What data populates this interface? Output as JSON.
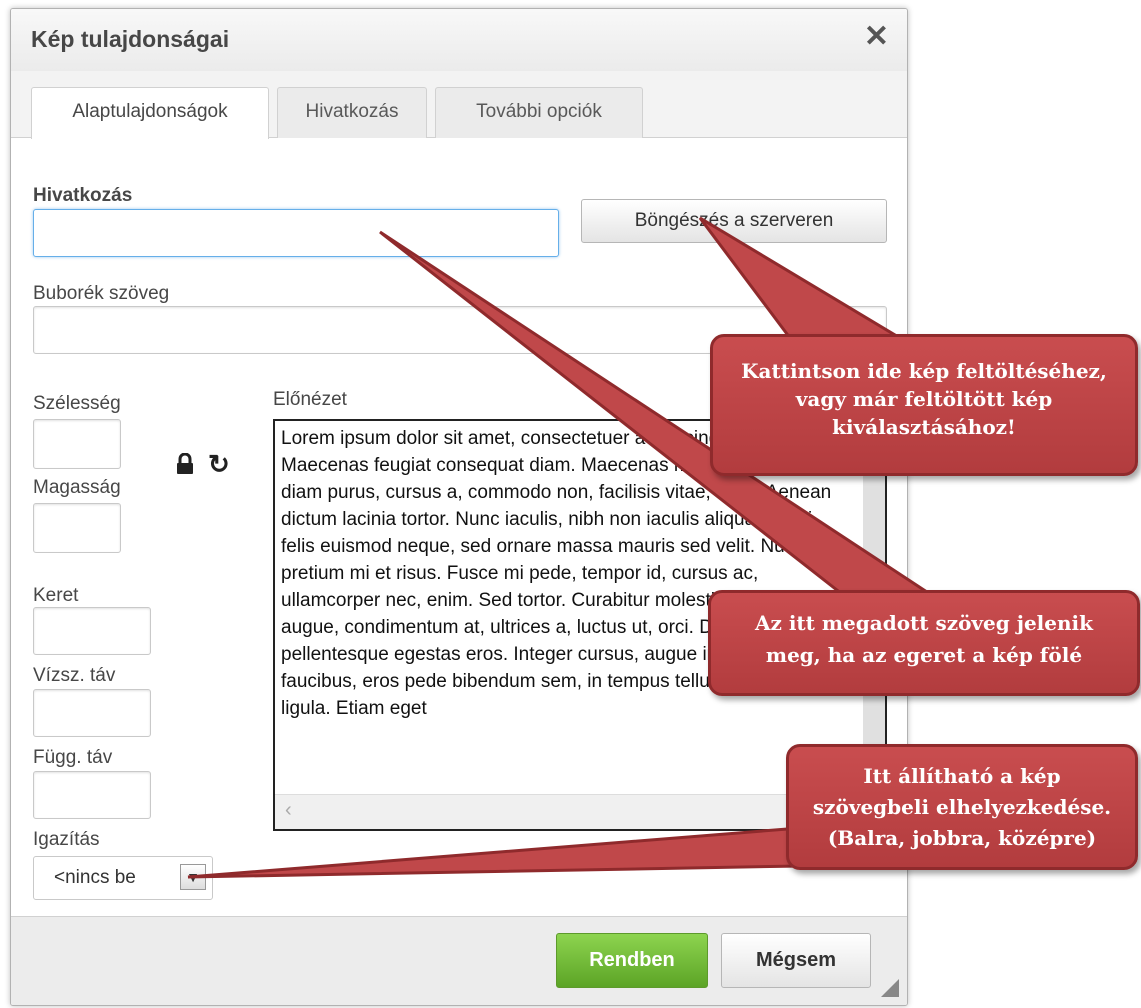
{
  "dialog": {
    "title": "Kép tulajdonságai",
    "close_icon": "close-icon"
  },
  "tabs": [
    {
      "label": "Alaptulajdonságok",
      "active": true
    },
    {
      "label": "Hivatkozás",
      "active": false
    },
    {
      "label": "További opciók",
      "active": false
    }
  ],
  "form": {
    "url_label": "Hivatkozás",
    "url_value": "",
    "browse_button": "Böngészés a szerveren",
    "alt_label": "Buborék szöveg",
    "alt_value": "",
    "width_label": "Szélesség",
    "height_label": "Magasság",
    "lock_icon": "lock-icon",
    "reset_icon": "reset-size-icon",
    "border_label": "Keret",
    "hspace_label": "Vízsz. táv",
    "vspace_label": "Függ. táv",
    "align_label": "Igazítás",
    "align_value": "<nincs be"
  },
  "preview": {
    "label": "Előnézet",
    "text": "Lorem ipsum dolor sit amet, consectetuer adipiscing elit. Maecenas feugiat consequat diam. Maecenas metus. Vivamus diam purus, cursus a, commodo non, facilisis vitae, nulla. Aenean dictum lacinia tortor. Nunc iaculis, nibh non iaculis aliquam, orci felis euismod neque, sed ornare massa mauris sed velit. Nulla pretium mi et risus. Fusce mi pede, tempor id, cursus ac, ullamcorper nec, enim. Sed tortor. Curabitur molestie. Duis velit augue, condimentum at, ultrices a, luctus ut, orci. Donec pellentesque egestas eros. Integer cursus, augue in cursus faucibus, eros pede bibendum sem, in tempus tellus justo quis ligula. Etiam eget"
  },
  "footer": {
    "ok_button": "Rendben",
    "cancel_button": "Mégsem"
  },
  "callouts": {
    "browse": "Kattintson ide kép feltöltéséhez, vagy már feltöltött kép kiválasztásához!",
    "alt": "Az itt megadott szöveg jelenik meg, ha az egeret a kép fölé",
    "align": "Itt állítható a kép szövegbeli elhelyezkedése. (Balra, jobbra, középre)"
  },
  "colors": {
    "callout": "#c0484a",
    "ok_button": "#6cb535"
  }
}
